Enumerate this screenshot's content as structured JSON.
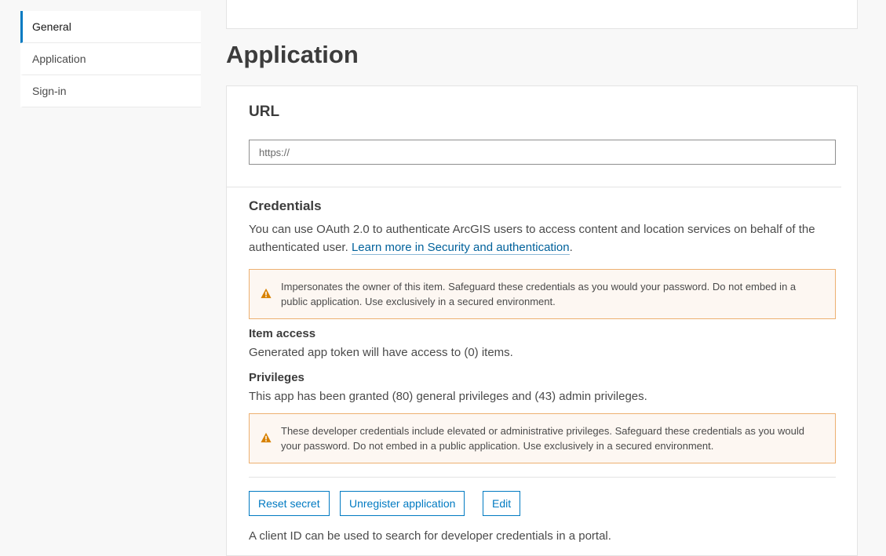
{
  "sidebar": {
    "items": [
      {
        "label": "General",
        "active": true
      },
      {
        "label": "Application",
        "active": false
      },
      {
        "label": "Sign-in",
        "active": false
      }
    ]
  },
  "page": {
    "title": "Application"
  },
  "url_section": {
    "heading": "URL",
    "input_placeholder": "https://",
    "input_value": ""
  },
  "credentials": {
    "heading": "Credentials",
    "description": "You can use OAuth 2.0 to authenticate ArcGIS users to access content and location services on behalf of the authenticated user. ",
    "link_text": "Learn more in Security and authentication",
    "link_suffix": ".",
    "notice1": "Impersonates the owner of this item. Safeguard these credentials as you would your password. Do not embed in a public application. Use exclusively in a secured environment.",
    "item_access_heading": "Item access",
    "item_access_text": "Generated app token will have access to (0) items.",
    "privileges_heading": "Privileges",
    "privileges_text": "This app has been granted (80) general privileges and (43) admin privileges.",
    "notice2": "These developer credentials include elevated or administrative privileges. Safeguard these credentials as you would your password. Do not embed in a public application. Use exclusively in a secured environment."
  },
  "actions": {
    "reset_label": "Reset secret",
    "unregister_label": "Unregister application",
    "edit_label": "Edit"
  },
  "client_id_text": "A client ID can be used to search for developer credentials in a portal.",
  "colors": {
    "accent": "#007ac2",
    "link": "#00619b",
    "warning": "#edb071",
    "warning_icon": "#d88100"
  },
  "icons": {
    "warning": "warning-triangle-icon"
  }
}
